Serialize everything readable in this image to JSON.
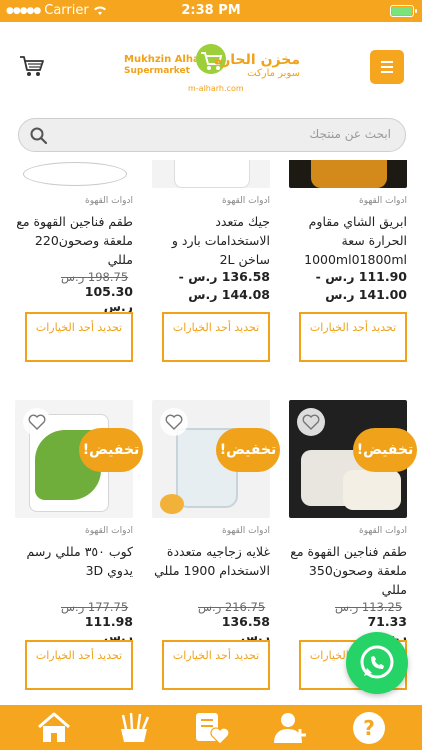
{
  "status_bar": {
    "carrier": "Carrier",
    "time": "2:38 PM"
  },
  "header": {
    "logo_en_line1": "Mukhzin Alharh",
    "logo_en_line2": "Supermarket",
    "logo_ar_line1": "مخزن الحارة",
    "logo_ar_line2": "سوبر ماركت",
    "logo_domain": "m-alharh.com",
    "icons": {
      "cart": "shopping-cart-icon",
      "menu": "hamburger-menu-icon"
    }
  },
  "search": {
    "placeholder": "ابحث عن منتجك"
  },
  "products_row1": [
    {
      "category": "ادوات القهوة",
      "name": "ابريق الشاي مقاوم الحرارة سعة 1000ml01800ml",
      "price_range_line1": "111.90 ر.س -",
      "price_range_line2": "141.00 ر.س",
      "button": "تحديد أحد الخيارات"
    },
    {
      "category": "ادوات القهوة",
      "name": "جيك متعدد الاستخدامات بارد و ساخن 2L",
      "price_range_line1": "136.58 ر.س -",
      "price_range_line2": "144.08 ر.س",
      "button": "تحديد أحد الخيارات"
    },
    {
      "category": "ادوات القهوة",
      "name": "طقم فناجين القهوة مع ملعقة وصحون220 مللي",
      "old_price": "198.75 ر.س",
      "price": "105.30 ر.س",
      "button": "تحديد أحد الخيارات"
    }
  ],
  "products_row2": [
    {
      "category": "ادوات القهوة",
      "name": "طقم فناجين القهوة مع ملعقة وصحون350 مللي",
      "old_price": "113.25 ر.س",
      "price": "71.33 ر.س",
      "badge": "تخفيض!",
      "button": "تحديد أحد الخيارات"
    },
    {
      "category": "ادوات القهوة",
      "name": "غلايه زجاجيه متعددة الاستخدام 1900 مللي",
      "old_price": "216.75 ر.س",
      "price": "136.58 ر.س",
      "badge": "تخفيض!",
      "button": "تحديد أحد الخيارات"
    },
    {
      "category": "ادوات القهوة",
      "name": "كوب ٣٥٠ مللي رسم يدوي 3D",
      "old_price": "177.75 ر.س",
      "price": "111.98 ر.س",
      "badge": "تخفيض!",
      "button": "تحديد أحد الخيارات"
    }
  ],
  "floating": {
    "icon": "whatsapp-icon"
  },
  "bottom_nav": {
    "items": [
      "home-icon",
      "categories-icon",
      "wishlist-icon",
      "account-icon",
      "help-icon"
    ]
  },
  "colors": {
    "brand": "#f6a51e",
    "accent": "#f0a21a",
    "whatsapp": "#25d366"
  }
}
